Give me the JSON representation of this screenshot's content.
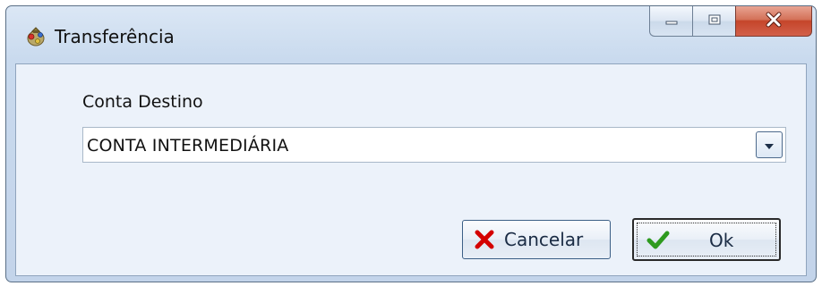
{
  "window": {
    "title": "Transferência",
    "icon": "money-bag-icon",
    "controls": [
      "minimize-icon",
      "maximize-icon",
      "close-icon"
    ]
  },
  "form": {
    "field_label": "Conta Destino",
    "field_value": "CONTA INTERMEDIÁRIA"
  },
  "buttons": {
    "cancel_label": "Cancelar",
    "cancel_icon": "red-x-icon",
    "ok_label": "Ok",
    "ok_icon": "green-check-icon"
  },
  "colors": {
    "close_button": "#c5452a",
    "cancel_icon": "#d40000",
    "ok_icon": "#2e9a1e"
  }
}
